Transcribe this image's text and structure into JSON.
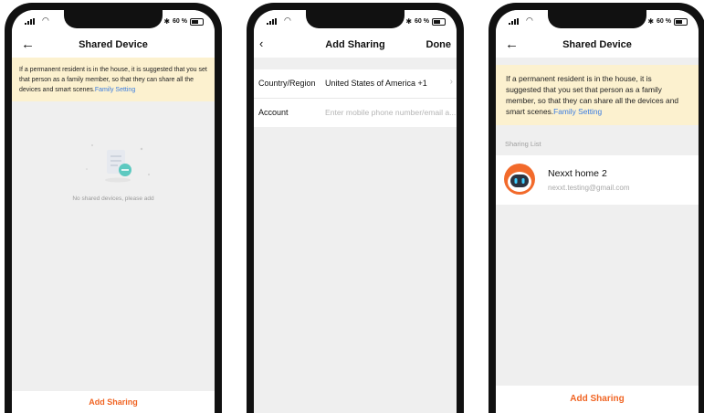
{
  "phone1": {
    "status": {
      "battery": "60 %"
    },
    "title": "Shared Device",
    "notice": "If a permanent resident is in the house, it is suggested that you set that person as a family member, so that they can share all the devices and smart scenes.",
    "notice_link": "Family Setting",
    "empty_text": "No shared devices, please add",
    "bottom_button": "Add Sharing"
  },
  "phone2": {
    "status": {
      "battery": "60 %"
    },
    "title": "Add Sharing",
    "done": "Done",
    "country_label": "Country/Region",
    "country_value": "United States of America +1",
    "account_label": "Account",
    "account_placeholder": "Enter mobile phone number/email a..."
  },
  "phone3": {
    "status": {
      "battery": "60 %"
    },
    "title": "Shared Device",
    "notice": "If a permanent resident is in the house, it is suggested that you set that person as a family member, so that they can share all the devices and smart scenes.",
    "notice_link": "Family Setting",
    "list_label": "Sharing List",
    "member": {
      "name": "Nexxt home 2",
      "email": "nexxt.testing@gmail.com"
    },
    "bottom_button": "Add Sharing"
  },
  "colors": {
    "accent": "#f06524",
    "link": "#3a7ce0",
    "notice_bg": "#fcf1cf"
  },
  "icons": [
    "signal-icon",
    "wifi-icon",
    "bluetooth-icon",
    "battery-icon",
    "back-arrow-icon",
    "chevron-left-icon",
    "chevron-right-icon",
    "empty-list-illustration",
    "robot-avatar-icon"
  ]
}
